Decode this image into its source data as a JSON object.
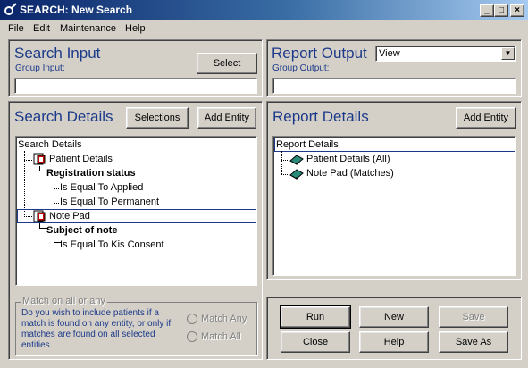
{
  "window": {
    "title": "SEARCH: New Search",
    "minimize": "_",
    "maximize": "□",
    "close": "×"
  },
  "menu": {
    "file": "File",
    "edit": "Edit",
    "maintenance": "Maintenance",
    "help": "Help"
  },
  "search_input": {
    "title": "Search Input",
    "sublabel": "Group Input:",
    "select_button": "Select",
    "value": ""
  },
  "report_output": {
    "title": "Report Output",
    "sublabel": "Group Output:",
    "combo_value": "View",
    "value": ""
  },
  "search_details": {
    "title": "Search Details",
    "selections_button": "Selections",
    "add_entity_button": "Add Entity",
    "tree": {
      "root": "Search Details",
      "n1": "Patient Details",
      "n2": "Registration status",
      "n3": "Is Equal To Applied",
      "n4": "Is Equal To Permanent",
      "n5": "Note Pad",
      "n6": "Subject of note",
      "n7": "Is Equal To Kis Consent"
    }
  },
  "report_details": {
    "title": "Report Details",
    "add_entity_button": "Add Entity",
    "tree": {
      "root": "Report Details",
      "n1": "Patient Details (All)",
      "n2": "Note Pad (Matches)"
    }
  },
  "match": {
    "title": "Match on all or any",
    "l1": "Do you wish to include patients if a",
    "l2": "match is found on any entity, or only if",
    "l3": "matches are found on all selected",
    "l4": "entities.",
    "any": "Match Any",
    "all": "Match All"
  },
  "actions": {
    "run": "Run",
    "new": "New",
    "save": "Save",
    "close": "Close",
    "help": "Help",
    "save_as": "Save As"
  }
}
